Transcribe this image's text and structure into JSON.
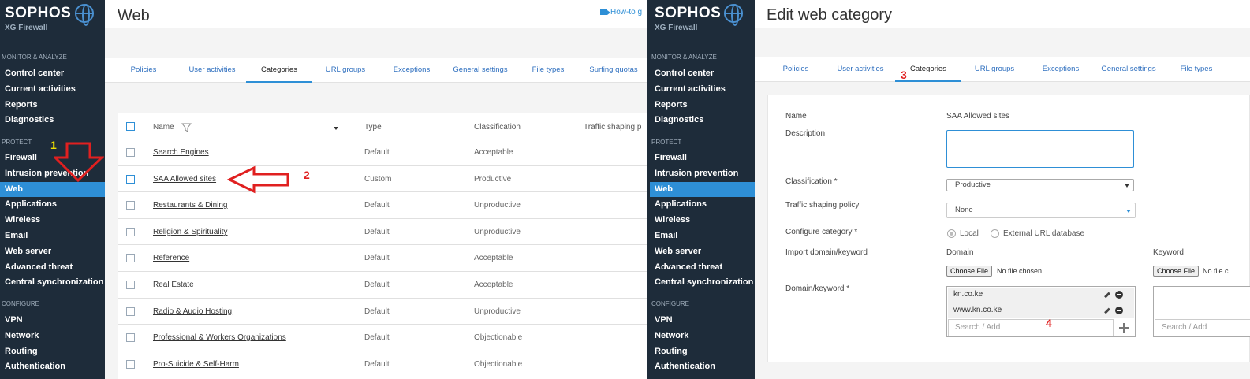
{
  "left": {
    "sidebar": {
      "brand": "SOPHOS",
      "product": "XG Firewall",
      "sections": [
        {
          "heading": "MONITOR & ANALYZE",
          "items": [
            "Control center",
            "Current activities",
            "Reports",
            "Diagnostics"
          ]
        },
        {
          "heading": "PROTECT",
          "items": [
            "Firewall",
            "Intrusion prevention",
            "Web",
            "Applications",
            "Wireless",
            "Email",
            "Web server",
            "Advanced threat",
            "Central synchronization"
          ]
        },
        {
          "heading": "CONFIGURE",
          "items": [
            "VPN",
            "Network",
            "Routing",
            "Authentication"
          ]
        }
      ],
      "active_item": "Web"
    },
    "page_title": "Web",
    "howto_label": "How-to g",
    "tabs": [
      "Policies",
      "User activities",
      "Categories",
      "URL groups",
      "Exceptions",
      "General settings",
      "File types",
      "Surfing quotas"
    ],
    "active_tab": "Categories",
    "table": {
      "columns": [
        "Name",
        "Type",
        "Classification",
        "Traffic shaping p"
      ],
      "rows": [
        {
          "name": "Search Engines",
          "type": "Default",
          "classification": "Acceptable"
        },
        {
          "name": "SAA Allowed sites",
          "type": "Custom",
          "classification": "Productive"
        },
        {
          "name": "Restaurants & Dining",
          "type": "Default",
          "classification": "Unproductive"
        },
        {
          "name": "Religion & Spirituality",
          "type": "Default",
          "classification": "Unproductive"
        },
        {
          "name": "Reference",
          "type": "Default",
          "classification": "Acceptable"
        },
        {
          "name": "Real Estate",
          "type": "Default",
          "classification": "Acceptable"
        },
        {
          "name": "Radio & Audio Hosting",
          "type": "Default",
          "classification": "Unproductive"
        },
        {
          "name": "Professional & Workers Organizations",
          "type": "Default",
          "classification": "Objectionable"
        },
        {
          "name": "Pro-Suicide & Self-Harm",
          "type": "Default",
          "classification": "Objectionable"
        }
      ]
    },
    "annotations": {
      "one": "1",
      "two": "2"
    }
  },
  "right": {
    "sidebar": {
      "brand": "SOPHOS",
      "product": "XG Firewall",
      "sections": [
        {
          "heading": "MONITOR & ANALYZE",
          "items": [
            "Control center",
            "Current activities",
            "Reports",
            "Diagnostics"
          ]
        },
        {
          "heading": "PROTECT",
          "items": [
            "Firewall",
            "Intrusion prevention",
            "Web",
            "Applications",
            "Wireless",
            "Email",
            "Web server",
            "Advanced threat",
            "Central synchronization"
          ]
        },
        {
          "heading": "CONFIGURE",
          "items": [
            "VPN",
            "Network",
            "Routing",
            "Authentication"
          ]
        }
      ],
      "active_item": "Web"
    },
    "page_title": "Edit web category",
    "tabs": [
      "Policies",
      "User activities",
      "Categories",
      "URL groups",
      "Exceptions",
      "General settings",
      "File types"
    ],
    "active_tab": "Categories",
    "form": {
      "name_label": "Name",
      "name_value": "SAA Allowed sites",
      "description_label": "Description",
      "classification_label": "Classification *",
      "classification_value": "Productive",
      "traffic_label": "Traffic shaping policy",
      "traffic_value": "None",
      "configure_label": "Configure category *",
      "configure_options": [
        "Local",
        "External URL database"
      ],
      "configure_selected": "Local",
      "import_label": "Import domain/keyword",
      "domain_col": "Domain",
      "keyword_col": "Keyword",
      "choose_file": "Choose File",
      "no_file": "No file chosen",
      "no_file_short": "No file c",
      "domain_keyword_label": "Domain/keyword *",
      "domains": [
        "kn.co.ke",
        "www.kn.co.ke"
      ],
      "search_placeholder": "Search / Add"
    },
    "annotations": {
      "three": "3",
      "four": "4"
    }
  },
  "colors": {
    "sidebar_bg": "#1e2c3a",
    "accent": "#2e8fd6",
    "annotation_red": "#e02020",
    "annotation_yellow": "#f0e000"
  }
}
